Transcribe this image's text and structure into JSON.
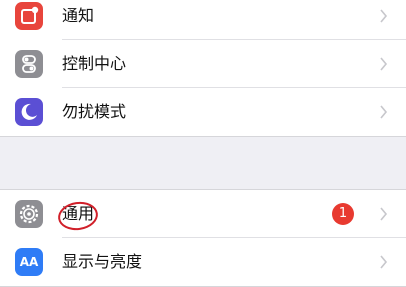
{
  "group1": {
    "items": [
      {
        "label": "通知",
        "icon": "notifications-icon",
        "icon_color": "#e8453c"
      },
      {
        "label": "控制中心",
        "icon": "control-center-icon",
        "icon_color": "#8e8e93"
      },
      {
        "label": "勿扰模式",
        "icon": "do-not-disturb-icon",
        "icon_color": "#5b4fd4"
      }
    ]
  },
  "group2": {
    "items": [
      {
        "label": "通用",
        "icon": "gear-icon",
        "icon_color": "#8e8e93",
        "badge": "1"
      },
      {
        "label": "显示与亮度",
        "icon": "display-brightness-icon",
        "icon_color": "#2f7cf6",
        "icon_text": "AA"
      }
    ]
  },
  "colors": {
    "background": "#efeff4",
    "badge": "#e83a30",
    "annotation_circle": "#d1202a"
  }
}
